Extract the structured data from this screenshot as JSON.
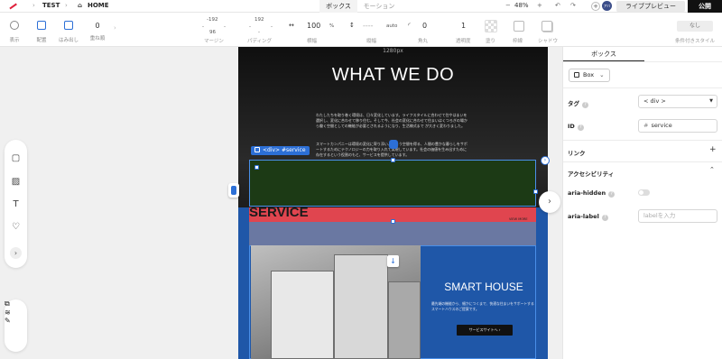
{
  "topbar": {
    "project": "TEST",
    "page": "HOME",
    "tabs": [
      "ボックス",
      "モーション"
    ],
    "zoom": "48%",
    "avatar": "アバ",
    "preview_label": "ライブプレビュー",
    "publish_label": "公開"
  },
  "toolbar": {
    "items": [
      {
        "label": "表示",
        "icon": "eye-icon"
      },
      {
        "label": "配置",
        "icon": "position-icon"
      },
      {
        "label": "はみ出し",
        "icon": "overflow-icon"
      },
      {
        "label": "重ね順",
        "value": "0"
      }
    ],
    "margin": {
      "label": "マージン",
      "top": "-192",
      "bottom": "96",
      "left": "-",
      "right": "-"
    },
    "padding": {
      "label": "パディング",
      "top": "192",
      "bottom": "-",
      "left": "-",
      "right": "-"
    },
    "width": {
      "label": "横幅",
      "value": "100",
      "unit": "%"
    },
    "height": {
      "label": "縦幅",
      "value": "----",
      "unit": "auto"
    },
    "radius": {
      "label": "角丸",
      "value": "0"
    },
    "opacity": {
      "label": "透明度",
      "value": "1"
    },
    "fill": {
      "label": "塗り"
    },
    "border": {
      "label": "枠線"
    },
    "shadow": {
      "label": "シャドウ"
    },
    "conditional": {
      "label": "条件付きスタイル",
      "value": "なし"
    }
  },
  "canvas": {
    "width_label": "1280px",
    "heading": "WHAT WE DO",
    "para1": "わたしたちを取り巻く環境は、日々変化しています。ライフスタイルに合わせて住やはまいを選択し、変化に合わせて移り住む。そして今、社会の変化に合わせて住まいはくつろぎの場から働く空間としての機能が必要とされるようになり、生活様式まで が大きく変わりました。",
    "para2": "スマートカンパニーは環境の変化に寄り添い、住まう空間を得る、人間の豊かな暮らしをサポートするためにテクノロジーの力を取り入れて実現しています。社会の価値を生み出すために存在するという役割のもと、サービスを提供しています。",
    "selection_tag": "<div> #service",
    "service_title": "SERVICE",
    "view_more": "VIEW MORE",
    "card_title": "SMART HOUSE",
    "card_text": "最先端の機能から、細かにつくまで、快適な住まいをサポートするスマートハウスのご提案です。",
    "card_button": "サービスサイトへ ›"
  },
  "panel": {
    "tab": "ボックス",
    "box_type": "Box",
    "tag_label": "タグ",
    "tag_value": "< div >",
    "id_label": "ID",
    "id_value": "service",
    "link_label": "リンク",
    "a11y_label": "アクセシビリティ",
    "aria_hidden_label": "aria-hidden",
    "aria_label_label": "aria-label",
    "aria_label_placeholder": "labelを入力"
  },
  "colors": {
    "accent": "#2c6fd6",
    "publish": "#111111",
    "service_red": "#e0454f",
    "card_blue": "#1f57a8"
  }
}
